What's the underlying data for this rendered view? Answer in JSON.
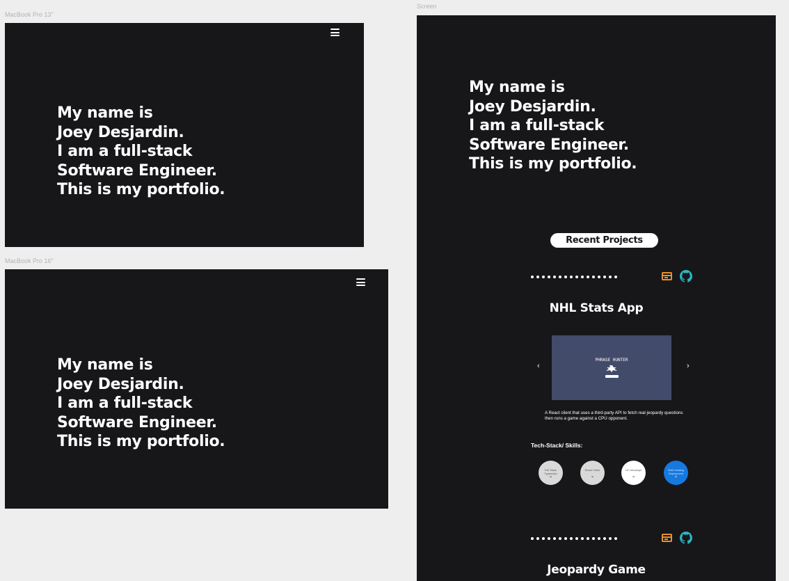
{
  "frames": {
    "macbook13": {
      "label": "MacBook Pro 13\""
    },
    "macbook16": {
      "label": "MacBook Pro 16\""
    },
    "screen": {
      "label": "Screen"
    }
  },
  "hero_lines": [
    "My name is",
    "Joey Desjardin.",
    "I am a full-stack",
    "Software Engineer.",
    "This is my portfolio."
  ],
  "recent_projects_label": "Recent Projects",
  "projects": [
    {
      "title": "NHL Stats App",
      "screenshot_title": "PHRASE HUNTER",
      "description": "A React client that uses a third-party API to  fetch real jeopardy questions then runs a game against a CPU opponent.",
      "prev_arrow": "‹",
      "next_arrow": "›",
      "skills_label": "Tech-Stack/ Skills:",
      "skills": [
        {
          "label": "Full Stack Typescript",
          "color": "#d9d9d9"
        },
        {
          "label": "React Client",
          "color": "#d9d9d9"
        },
        {
          "label": "UI / Mockups",
          "color": "#ffffff"
        },
        {
          "label": "Web Hosting Deployment",
          "color": "#1679e0"
        }
      ]
    },
    {
      "title": "Jeopardy Game"
    }
  ],
  "icons": {
    "menu": "hamburger-icon",
    "live_site": "browser-window-icon",
    "repo": "github-icon",
    "skill_expand": "chevron-down-icon"
  },
  "colors": {
    "background": "#eeeeee",
    "frame": "#17171a",
    "accent_orange": "#e8922e",
    "accent_teal": "#2bb5c0",
    "image_bg": "#434b6b",
    "skill_blue": "#1679e0"
  }
}
